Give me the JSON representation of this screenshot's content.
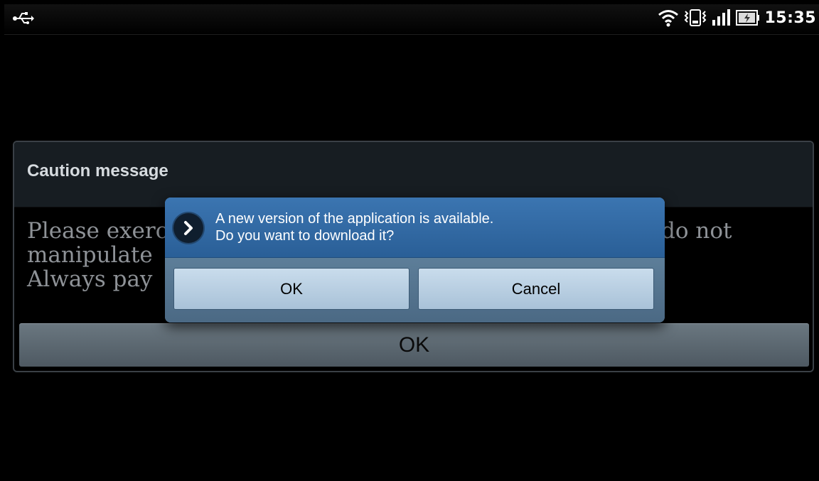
{
  "status_bar": {
    "time": "15:35",
    "icons": [
      "usb-icon",
      "wifi-icon",
      "vibrate-icon",
      "signal-icon",
      "battery-charging-icon"
    ]
  },
  "caution_dialog": {
    "title": "Caution message",
    "body_lines": [
      "Please exerc",
      "manipulate",
      "Always pay"
    ],
    "body_right": "do not",
    "ok_label": "OK"
  },
  "update_dialog": {
    "icon": "chevron-right-icon",
    "message_line1": "A new version of the application is available.",
    "message_line2": "Do you want to download it?",
    "ok_label": "OK",
    "cancel_label": "Cancel"
  },
  "colors": {
    "dialog_header": "#3b75b1",
    "dialog_body": "#5d7e99",
    "button": "#c9dcec",
    "caution_header": "#171d22"
  }
}
